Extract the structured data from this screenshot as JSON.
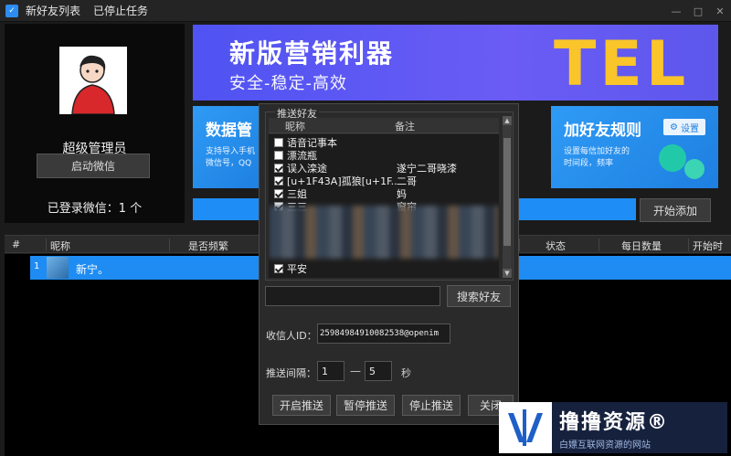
{
  "titlebar": {
    "menu": [
      "新好友列表",
      "已停止任务"
    ]
  },
  "profile": {
    "name": "超级管理员",
    "start_wechat_label": "启动微信",
    "logged_in_text": "已登录微信：1 个"
  },
  "banner": {
    "title": "新版营销利器",
    "subtitle": "安全-稳定-高效",
    "brand": "TEL"
  },
  "card_left": {
    "title": "数据管",
    "desc": [
      "支持导入手机",
      "微信号，QQ"
    ]
  },
  "card_right": {
    "title": "加好友规则",
    "button": "设置",
    "desc": [
      "设置每信加好友的",
      "时间段，频率"
    ]
  },
  "toolbar": {
    "start_add_label": "开始添加"
  },
  "table": {
    "headers": [
      "#",
      "昵称",
      "是否频繁",
      "状态",
      "每日数量",
      "开始时间"
    ],
    "rows": [
      {
        "index": "1",
        "name": "新宁。"
      }
    ]
  },
  "dialog": {
    "group_title": "推送好友",
    "col_nickname": "昵称",
    "col_note": "备注",
    "items": [
      {
        "name": "语音记事本",
        "note": "",
        "checked": false
      },
      {
        "name": "漂流瓶",
        "note": "",
        "checked": false
      },
      {
        "name": "误入滦途",
        "note": "遂宁二哥晓漆",
        "checked": true
      },
      {
        "name": "[u+1F43A]孤狼[u+1F...",
        "note": "二哥",
        "checked": true
      },
      {
        "name": "三姐",
        "note": "妈",
        "checked": true
      },
      {
        "name": "三三",
        "note": "窗帘",
        "checked": true
      },
      {
        "name": "平安",
        "note": "",
        "checked": true
      }
    ],
    "search_button": "搜索好友",
    "receiver_label": "收信人ID：",
    "receiver_value": "25984984910082538@openim",
    "interval_label": "推送间隔：",
    "interval_from": "1",
    "interval_dash": "—",
    "interval_to": "5",
    "interval_unit": "秒",
    "buttons": [
      "开启推送",
      "暂停推送",
      "停止推送",
      "关闭"
    ]
  },
  "watermark": {
    "title": "撸撸资源®",
    "subtitle": "白嫖互联网资源的网站"
  },
  "colors": {
    "accent": "#1e8cf2",
    "banner": "#5d57ec",
    "brand_yellow": "#f9c52a",
    "card": "#2f9bf5"
  }
}
